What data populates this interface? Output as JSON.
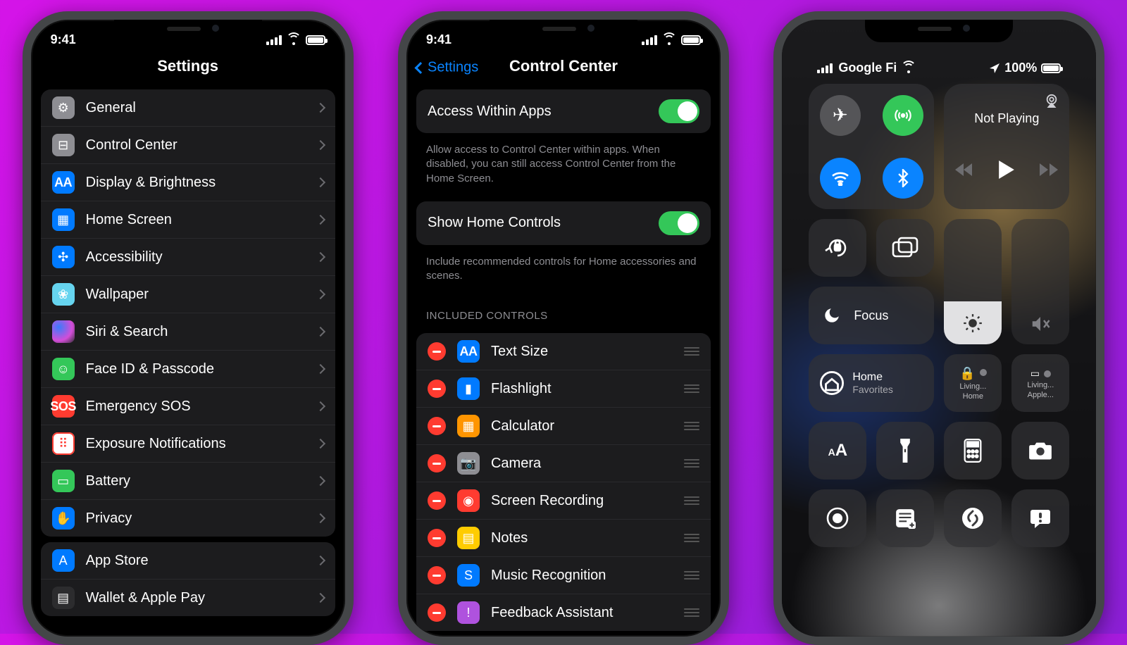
{
  "status": {
    "time": "9:41"
  },
  "phone1": {
    "title": "Settings",
    "groups": [
      [
        {
          "label": "General",
          "iconClass": "ic-gray",
          "glyph": "⚙︎"
        },
        {
          "label": "Control Center",
          "iconClass": "ic-gray",
          "glyph": "⊟"
        },
        {
          "label": "Display & Brightness",
          "iconClass": "ic-blue",
          "glyph": "AA",
          "small": true
        },
        {
          "label": "Home Screen",
          "iconClass": "ic-blue",
          "glyph": "▦"
        },
        {
          "label": "Accessibility",
          "iconClass": "ic-blue",
          "glyph": "✣"
        },
        {
          "label": "Wallpaper",
          "iconClass": "ic-cyan",
          "glyph": "❀"
        },
        {
          "label": "Siri & Search",
          "iconClass": "ic-siri",
          "glyph": ""
        },
        {
          "label": "Face ID & Passcode",
          "iconClass": "ic-green",
          "glyph": "☺"
        },
        {
          "label": "Emergency SOS",
          "iconClass": "ic-red",
          "glyph": "SOS",
          "small": true
        },
        {
          "label": "Exposure Notifications",
          "iconClass": "ic-red",
          "glyph": "⠿",
          "altbg": true
        },
        {
          "label": "Battery",
          "iconClass": "ic-green",
          "glyph": "▭"
        },
        {
          "label": "Privacy",
          "iconClass": "ic-blue",
          "glyph": "✋"
        }
      ],
      [
        {
          "label": "App Store",
          "iconClass": "ic-blue",
          "glyph": "A"
        },
        {
          "label": "Wallet & Apple Pay",
          "iconClass": "ic-dark",
          "glyph": "▤"
        }
      ]
    ]
  },
  "phone2": {
    "backLabel": "Settings",
    "title": "Control Center",
    "toggle1": {
      "label": "Access Within Apps",
      "caption": "Allow access to Control Center within apps. When disabled, you can still access Control Center from the Home Screen."
    },
    "toggle2": {
      "label": "Show Home Controls",
      "caption": "Include recommended controls for Home accessories and scenes."
    },
    "includedHeader": "INCLUDED CONTROLS",
    "included": [
      {
        "label": "Text Size",
        "iconClass": "ic-blue",
        "glyph": "AA",
        "small": true
      },
      {
        "label": "Flashlight",
        "iconClass": "ic-blue",
        "glyph": "▮"
      },
      {
        "label": "Calculator",
        "iconClass": "ic-orange",
        "glyph": "▦"
      },
      {
        "label": "Camera",
        "iconClass": "ic-gray",
        "glyph": "📷"
      },
      {
        "label": "Screen Recording",
        "iconClass": "ic-red",
        "glyph": "◉"
      },
      {
        "label": "Notes",
        "iconClass": "ic-yellow",
        "glyph": "▤"
      },
      {
        "label": "Music Recognition",
        "iconClass": "ic-blue",
        "glyph": "S"
      },
      {
        "label": "Feedback Assistant",
        "iconClass": "ic-purple",
        "glyph": "!"
      }
    ]
  },
  "phone3": {
    "carrier": "Google Fi",
    "batteryPct": "100%",
    "media": {
      "title": "Not Playing"
    },
    "focus": "Focus",
    "home": {
      "t1": "Home",
      "t2": "Favorites"
    },
    "lock1": {
      "l1": "Living...",
      "l2": "Home"
    },
    "lock2": {
      "l1": "Living...",
      "l2": "Apple..."
    }
  }
}
